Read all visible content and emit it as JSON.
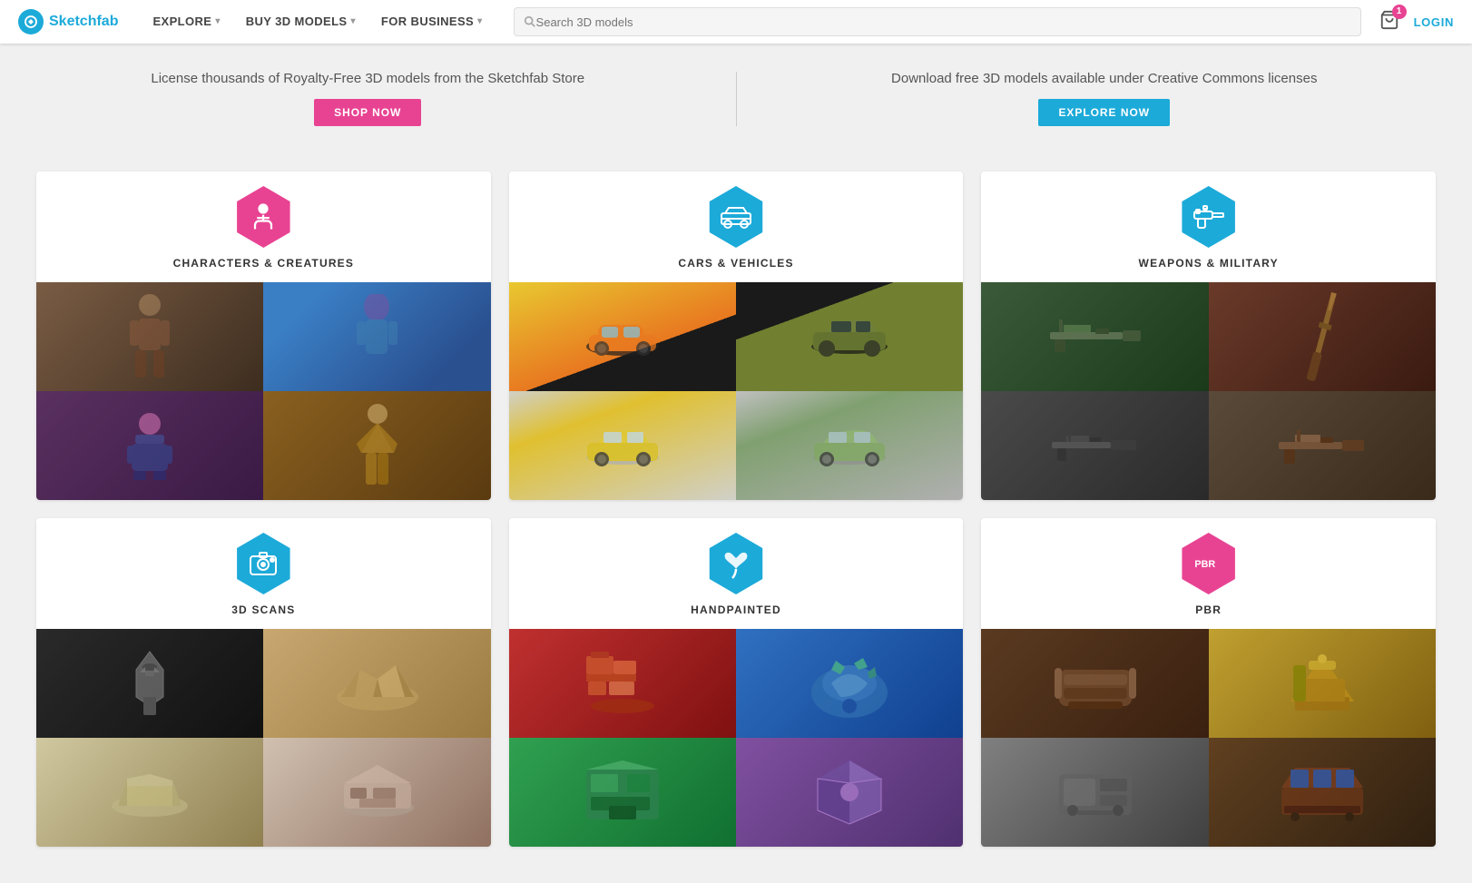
{
  "nav": {
    "logo_text": "Sketchfab",
    "links": [
      {
        "label": "EXPLORE",
        "has_dropdown": true
      },
      {
        "label": "BUY 3D MODELS",
        "has_dropdown": true
      },
      {
        "label": "FOR BUSINESS",
        "has_dropdown": true
      }
    ],
    "search_placeholder": "Search 3D models",
    "cart_badge": "1",
    "login_label": "LOGIN"
  },
  "promo": {
    "left_text": "License thousands of Royalty-Free 3D models from the Sketchfab Store",
    "left_btn": "SHOP NOW",
    "right_text": "Download free 3D models available under Creative Commons licenses",
    "right_btn": "EXPLORE NOW"
  },
  "categories": [
    {
      "id": "characters",
      "label": "CHARACTERS & CREATURES",
      "icon_type": "character",
      "hex_color": "pink",
      "images": [
        "c1",
        "c2",
        "c3",
        "c4"
      ]
    },
    {
      "id": "cars",
      "label": "CARS & VEHICLES",
      "icon_type": "car",
      "hex_color": "blue",
      "images": [
        "car1",
        "car2",
        "car3",
        "car4"
      ]
    },
    {
      "id": "weapons",
      "label": "WEAPONS & MILITARY",
      "icon_type": "weapon",
      "hex_color": "blue",
      "images": [
        "w1",
        "w2",
        "w3",
        "w4"
      ]
    },
    {
      "id": "scans",
      "label": "3D SCANS",
      "icon_type": "camera",
      "hex_color": "blue",
      "images": [
        "s1",
        "s2",
        "s3",
        "s4"
      ]
    },
    {
      "id": "handpainted",
      "label": "HANDPAINTED",
      "icon_type": "brush",
      "hex_color": "blue",
      "images": [
        "hp1",
        "hp2",
        "hp3",
        "hp4"
      ]
    },
    {
      "id": "pbr",
      "label": "PBR",
      "icon_type": "pbr",
      "hex_color": "pink",
      "images": [
        "pbr1",
        "pbr2",
        "pbr3",
        "pbr4"
      ]
    }
  ]
}
